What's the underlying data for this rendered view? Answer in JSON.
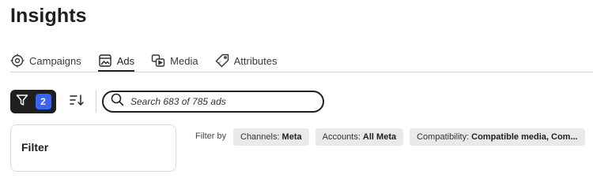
{
  "page": {
    "title": "Insights"
  },
  "tabs": [
    {
      "label": "Campaigns",
      "icon": "target-icon",
      "active": false
    },
    {
      "label": "Ads",
      "icon": "image-card-icon",
      "active": true
    },
    {
      "label": "Media",
      "icon": "media-icon",
      "active": false
    },
    {
      "label": "Attributes",
      "icon": "tag-icon",
      "active": false
    }
  ],
  "toolbar": {
    "filter_count": "2",
    "filter_icon": "funnel-icon",
    "sort_icon": "sort-icon",
    "search_placeholder": "Search 683 of 785 ads",
    "search_icon": "search-icon"
  },
  "filter_panel": {
    "title": "Filter"
  },
  "filters": {
    "label": "Filter by",
    "chips": [
      {
        "key": "Channels:",
        "value": "Meta"
      },
      {
        "key": "Accounts:",
        "value": "All Meta"
      },
      {
        "key": "Compatibility:",
        "value": "Compatible media, Com..."
      }
    ]
  },
  "colors": {
    "badge": "#3b63f5",
    "dark": "#1f1f1f",
    "chip": "#e9e9e9"
  }
}
